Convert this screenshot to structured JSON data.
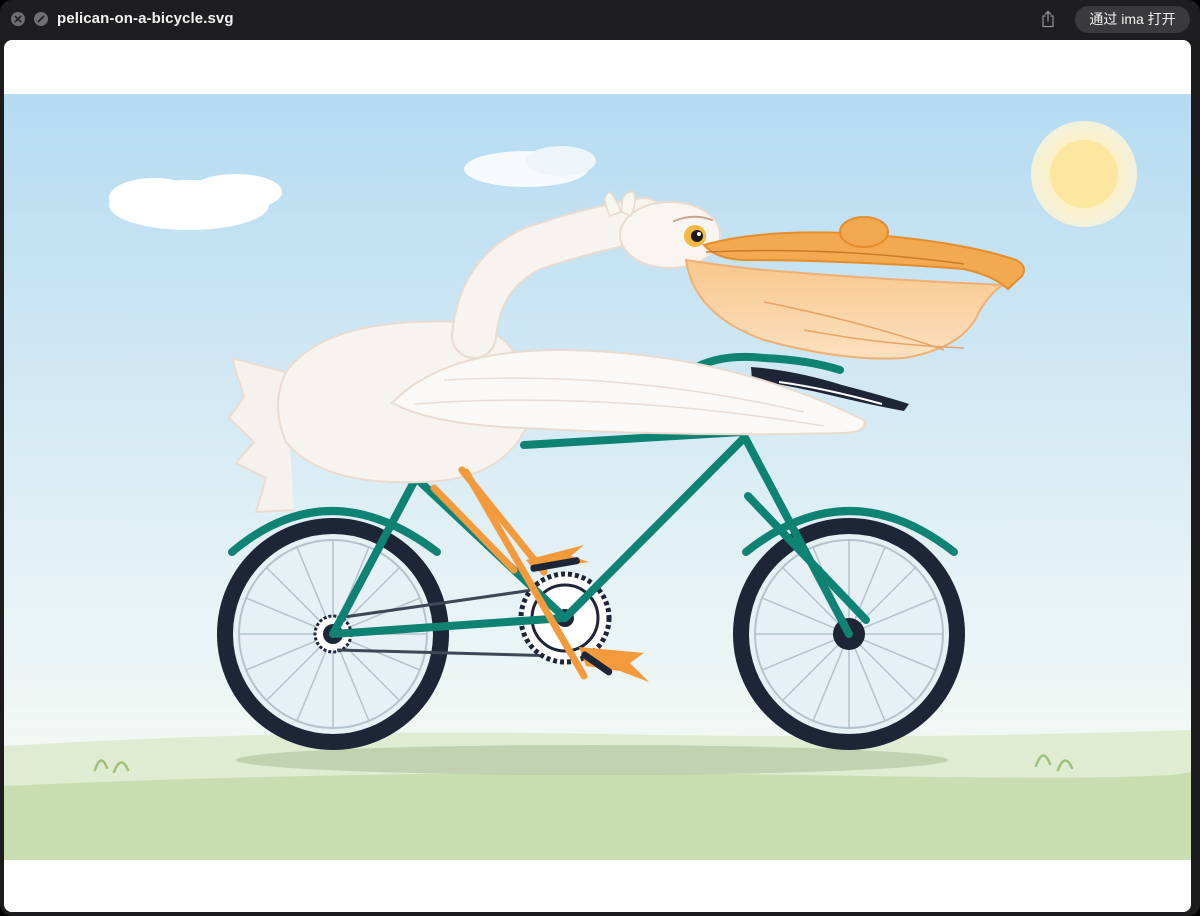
{
  "window": {
    "title": "pelican-on-a-bicycle.svg",
    "open_with_label": "通过 ima 打开"
  },
  "icons": {
    "close": "close-icon",
    "hide": "hide-icon",
    "share": "share-icon"
  },
  "colors": {
    "titlebar": "#1e1e20",
    "sky_top": "#b5dbf1",
    "sky_bottom": "#eef6f7",
    "grass": "#c9deb0",
    "frame": "#0e8374",
    "tire": "#1e2536",
    "beak": "#f2a94f",
    "sun": "#fbe7a0"
  }
}
